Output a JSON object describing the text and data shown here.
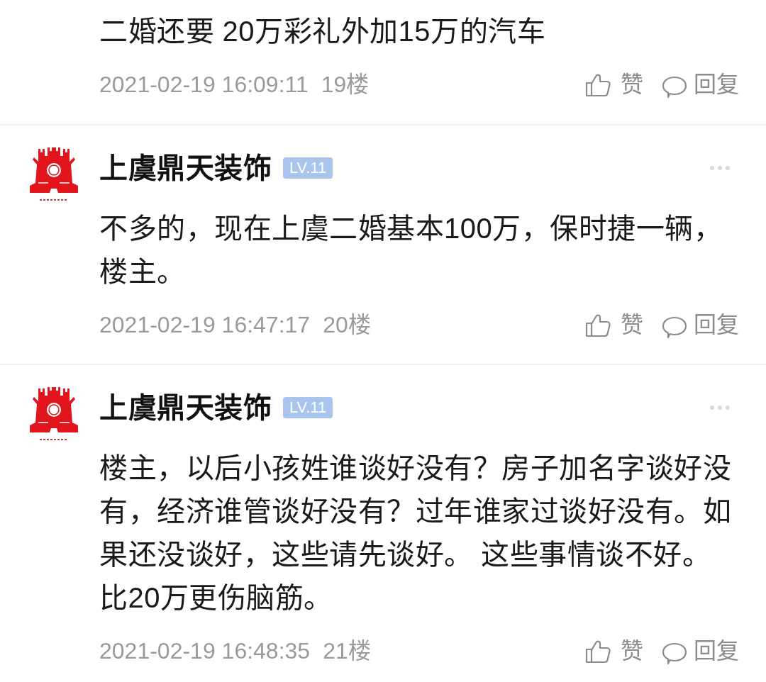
{
  "comments": [
    {
      "body": "二婚还要 20万彩礼外加15万的汽车",
      "time": "2021-02-19 16:09:11",
      "floor": "19楼",
      "like_label": "赞",
      "reply_label": "回复"
    },
    {
      "author": {
        "name": "上虞鼎天装饰",
        "level": "LV.11"
      },
      "body": "不多的，现在上虞二婚基本100万，保时捷一辆，楼主。",
      "time": "2021-02-19 16:47:17",
      "floor": "20楼",
      "like_label": "赞",
      "reply_label": "回复"
    },
    {
      "author": {
        "name": "上虞鼎天装饰",
        "level": "LV.11"
      },
      "body": "楼主，以后小孩姓谁谈好没有？房子加名字谈好没有，经济谁管谈好没有？过年谁家过谈好没有。如果还没谈好，这些请先谈好。 这些事情谈不好。比20万更伤脑筋。",
      "time": "2021-02-19 16:48:35",
      "floor": "21楼",
      "like_label": "赞",
      "reply_label": "回复"
    }
  ]
}
